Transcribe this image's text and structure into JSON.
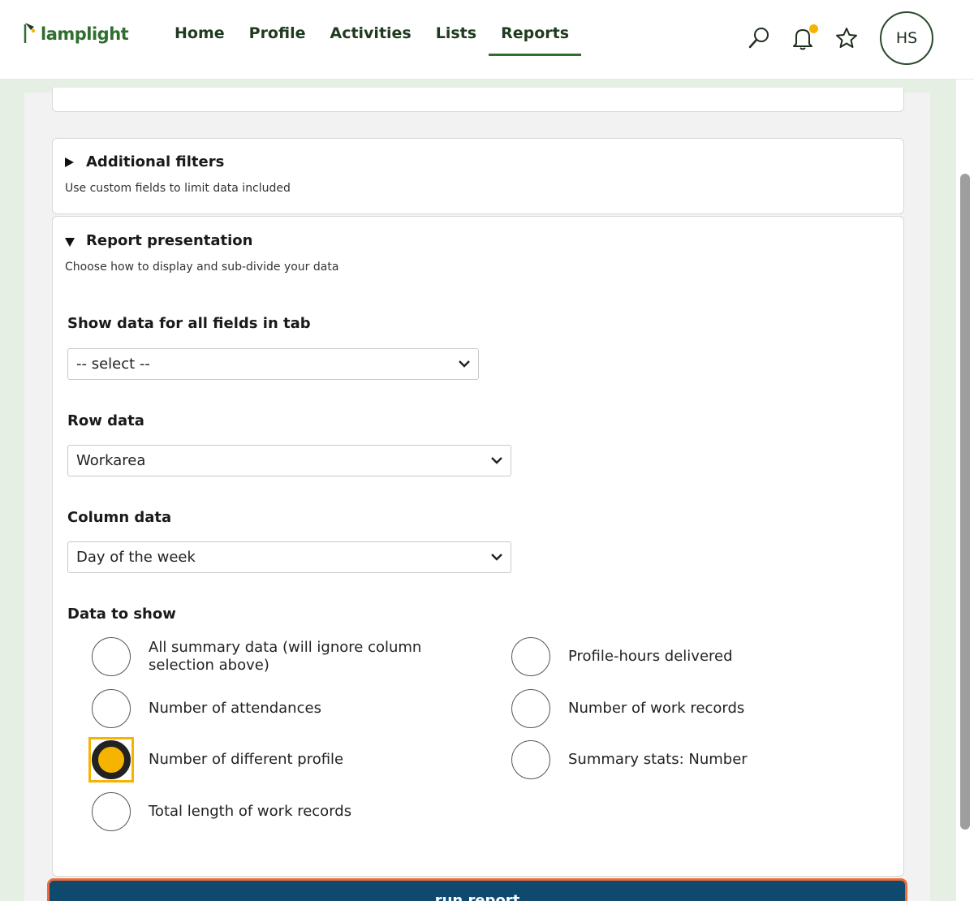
{
  "header": {
    "logo_text": "lamplight",
    "nav": [
      "Home",
      "Profile",
      "Activities",
      "Lists",
      "Reports"
    ],
    "active_nav": "Reports",
    "avatar_initials": "HS"
  },
  "filters": {
    "title": "Additional filters",
    "subtitle": "Use custom fields to limit data included"
  },
  "presentation": {
    "title": "Report presentation",
    "subtitle": "Choose how to display and sub-divide your data",
    "tab_label": "Show data for all fields in tab",
    "tab_value": "-- select --",
    "row_label": "Row data",
    "row_value": "Workarea",
    "column_label": "Column data",
    "column_value": "Day of the week",
    "data_label": "Data to show",
    "options": [
      {
        "label": "All summary data (will ignore column selection above)",
        "checked": false
      },
      {
        "label": "Profile-hours delivered",
        "checked": false
      },
      {
        "label": "Number of attendances",
        "checked": false
      },
      {
        "label": "Number of work records",
        "checked": false
      },
      {
        "label": "Number of different profile",
        "checked": true
      },
      {
        "label": "Summary stats: Number",
        "checked": false
      },
      {
        "label": "Total length of work records",
        "checked": false
      }
    ]
  },
  "run_button": "run report",
  "colors": {
    "brand_green": "#2f6e2f",
    "accent_yellow": "#f6b400",
    "button_blue": "#0f4a6e",
    "focus_orange": "#ef6b3c"
  }
}
